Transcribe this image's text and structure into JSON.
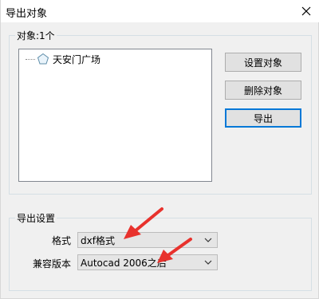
{
  "window": {
    "title": "导出对象"
  },
  "objects_group": {
    "label": "对象:1个",
    "tree_items": [
      {
        "label": "天安门广场"
      }
    ]
  },
  "buttons": {
    "set_object": "设置对象",
    "delete_object": "删除对象",
    "export": "导出"
  },
  "export_settings": {
    "label": "导出设置",
    "format": {
      "label": "格式",
      "value": "dxf格式"
    },
    "compat_version": {
      "label": "兼容版本",
      "value": "Autocad 2006之后"
    }
  },
  "icons": {
    "close": "close-icon",
    "tree_item": "pentagon-shape-icon",
    "dropdown": "chevron-down-icon"
  },
  "colors": {
    "annotation_arrow": "#e8322d",
    "default_button_border": "#0078d7"
  }
}
